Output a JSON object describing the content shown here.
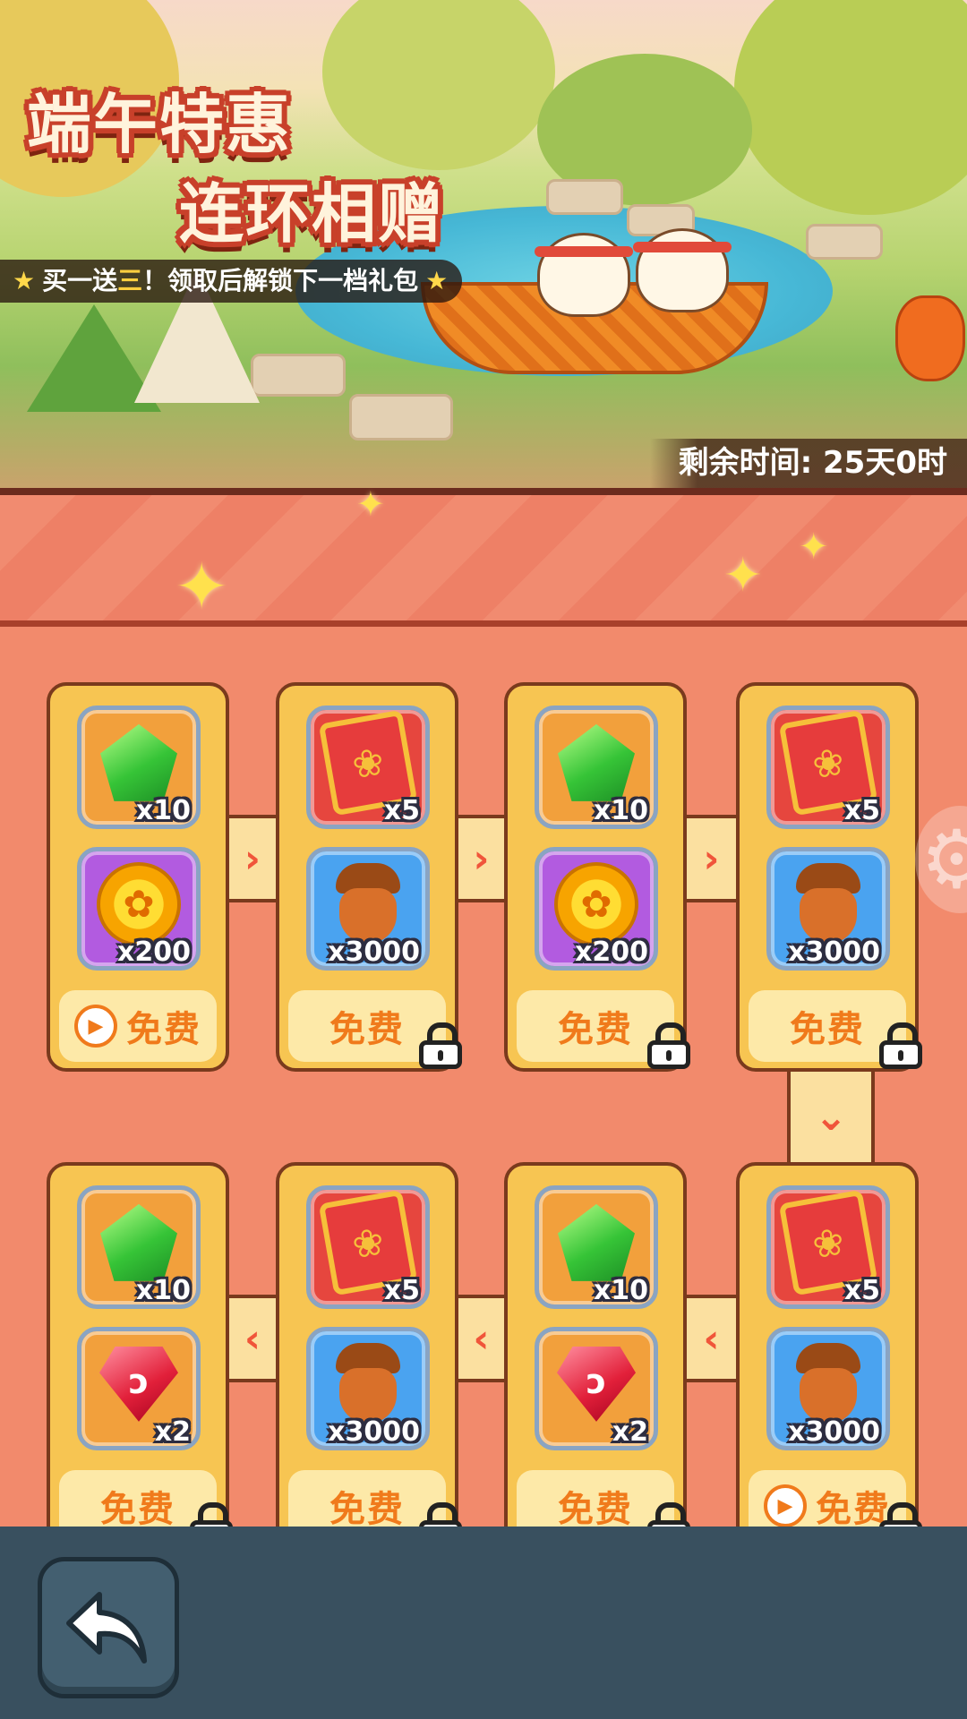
{
  "banner": {
    "title_line1": "端午特惠",
    "title_line2": "连环相赠",
    "subtitle_prefix": "买一送",
    "subtitle_highlight": "三",
    "subtitle_suffix": "！领取后解锁下一档礼包",
    "timer_label": "剩余时间: 25天0时"
  },
  "rows": [
    {
      "cards": [
        {
          "items": [
            {
              "icon": "green-gem-icon",
              "qty": "x10"
            },
            {
              "icon": "gold-coin-icon",
              "qty": "x200"
            }
          ],
          "claim": "免费",
          "ad": true,
          "locked": false
        },
        {
          "items": [
            {
              "icon": "red-ticket-icon",
              "qty": "x5"
            },
            {
              "icon": "acorn-icon",
              "qty": "x3000"
            }
          ],
          "claim": "免费",
          "ad": false,
          "locked": true
        },
        {
          "items": [
            {
              "icon": "green-gem-icon",
              "qty": "x10"
            },
            {
              "icon": "gold-coin-icon",
              "qty": "x200"
            }
          ],
          "claim": "免费",
          "ad": false,
          "locked": true
        },
        {
          "items": [
            {
              "icon": "red-ticket-icon",
              "qty": "x5"
            },
            {
              "icon": "acorn-icon",
              "qty": "x3000"
            }
          ],
          "claim": "免费",
          "ad": false,
          "locked": true
        }
      ]
    },
    {
      "cards": [
        {
          "items": [
            {
              "icon": "green-gem-icon",
              "qty": "x10"
            },
            {
              "icon": "red-ruby-icon",
              "qty": "x2"
            }
          ],
          "claim": "免费",
          "ad": false,
          "locked": true
        },
        {
          "items": [
            {
              "icon": "red-ticket-icon",
              "qty": "x5"
            },
            {
              "icon": "acorn-icon",
              "qty": "x3000"
            }
          ],
          "claim": "免费",
          "ad": false,
          "locked": true
        },
        {
          "items": [
            {
              "icon": "green-gem-icon",
              "qty": "x10"
            },
            {
              "icon": "red-ruby-icon",
              "qty": "x2"
            }
          ],
          "claim": "免费",
          "ad": false,
          "locked": true
        },
        {
          "items": [
            {
              "icon": "red-ticket-icon",
              "qty": "x5"
            },
            {
              "icon": "acorn-icon",
              "qty": "x3000"
            }
          ],
          "claim": "免费",
          "ad": true,
          "locked": true
        }
      ]
    }
  ],
  "colors": {
    "accent_orange": "#f07a1b",
    "card_gold": "#f7c552",
    "background_salmon": "#f28a6c",
    "bottom_bar": "#39505f"
  }
}
